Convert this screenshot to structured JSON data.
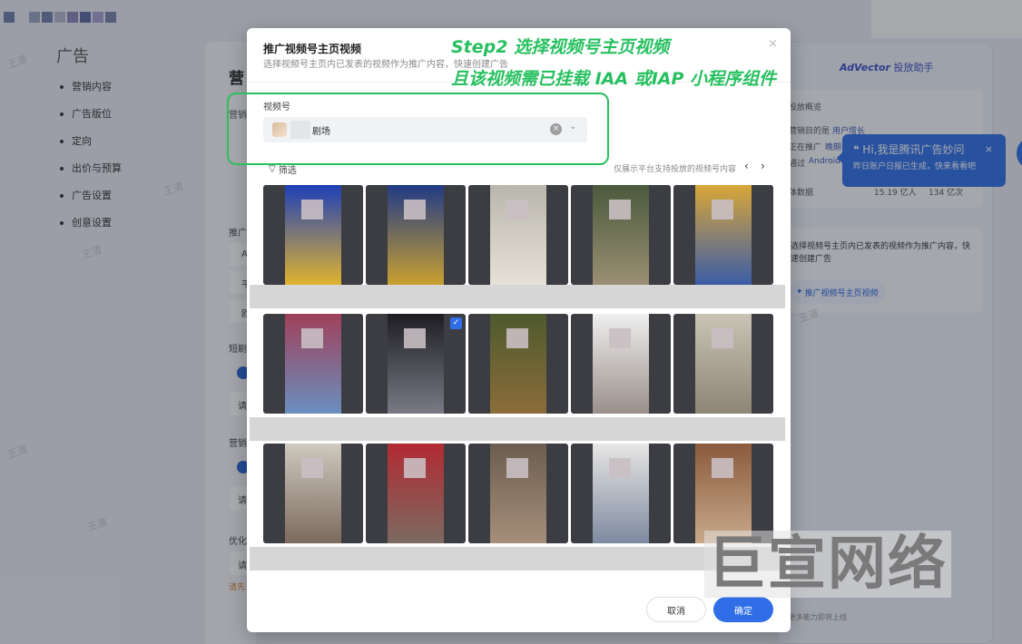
{
  "background": {
    "left_nav": {
      "title": "广告",
      "items": [
        "营销内容",
        "广告版位",
        "定向",
        "出价与预算",
        "广告设置",
        "创意设置"
      ]
    },
    "main": {
      "title_fragment": "营",
      "labels": [
        "营销",
        "推广",
        "短剧",
        "营销",
        "优化"
      ],
      "inputs": [
        "A",
        "平",
        "欧",
        "请",
        "请",
        "请"
      ],
      "warning_fragment": "请先"
    },
    "assistant_panel": {
      "title_brand": "AdVector",
      "title_rest": "投放助手",
      "overview_title": "投放概览",
      "row1_label": "营销目的是",
      "row1_value": "用户增长",
      "row2_label": "正在推广",
      "row2_value": "晚期",
      "row3_label": "通过",
      "row3_value": "Android",
      "row4_label": "体数据",
      "row4_v1": "15.19 亿人",
      "row4_v2": "134 亿次",
      "promo_desc": "选择视频号主页内已发表的视频作为推广内容，快速创建广告",
      "promo_button": "推广视频号主页视频",
      "footer": "更多能力即将上线"
    },
    "assistant_tip": {
      "greeting": "Hi,我是腾讯广告妙问",
      "message": "昨日账户日报已生成，快来看看吧",
      "close": "×"
    }
  },
  "modal": {
    "title": "推广视频号主页视频",
    "subtitle": "选择视频号主页内已发表的视频作为推广内容，快速创建广告",
    "close": "×",
    "channel_label": "视频号",
    "channel_name": "剧场",
    "filter_label": "筛选",
    "hint": "仅展示平台支持投放的视频号内容",
    "prev": "‹",
    "next": "›",
    "videos": [
      [
        {
          "selected": false,
          "c1": "#1d3fb8",
          "c2": "#e0b330"
        },
        {
          "selected": false,
          "c1": "#203a86",
          "c2": "#c9a030"
        },
        {
          "selected": false,
          "c1": "#b9b6ad",
          "c2": "#e6e1d6"
        },
        {
          "selected": false,
          "c1": "#4a5a3c",
          "c2": "#9b8f74"
        },
        {
          "selected": false,
          "c1": "#d9a637",
          "c2": "#3b5da8"
        }
      ],
      [
        {
          "selected": false,
          "c1": "#a0405a",
          "c2": "#6a8fbf"
        },
        {
          "selected": true,
          "c1": "#1d1d22",
          "c2": "#7a7a86"
        },
        {
          "selected": false,
          "c1": "#4e5a2e",
          "c2": "#8b6d3a"
        },
        {
          "selected": false,
          "c1": "#efefef",
          "c2": "#9a8f8a"
        },
        {
          "selected": false,
          "c1": "#c9c4b5",
          "c2": "#8d8576"
        }
      ],
      [
        {
          "selected": false,
          "c1": "#cfc9bf",
          "c2": "#7b6a5e"
        },
        {
          "selected": false,
          "c1": "#b22a33",
          "c2": "#7c6a60"
        },
        {
          "selected": false,
          "c1": "#6b5d4f",
          "c2": "#a68f7a"
        },
        {
          "selected": false,
          "c1": "#e8e6e4",
          "c2": "#7e8aa0"
        },
        {
          "selected": false,
          "c1": "#8a5a3d",
          "c2": "#c9a98a"
        }
      ]
    ],
    "cancel_label": "取消",
    "confirm_label": "确定"
  },
  "annotation": {
    "step_title": "Step2 选择视频号主页视频",
    "step_note": "且该视频需已挂载 IAA 或IAP 小程序组件",
    "watermark": "巨宣网络",
    "tile_mark": "王清"
  },
  "colors": {
    "accent": "#2f6ee6",
    "annotation_green": "#27c060"
  }
}
